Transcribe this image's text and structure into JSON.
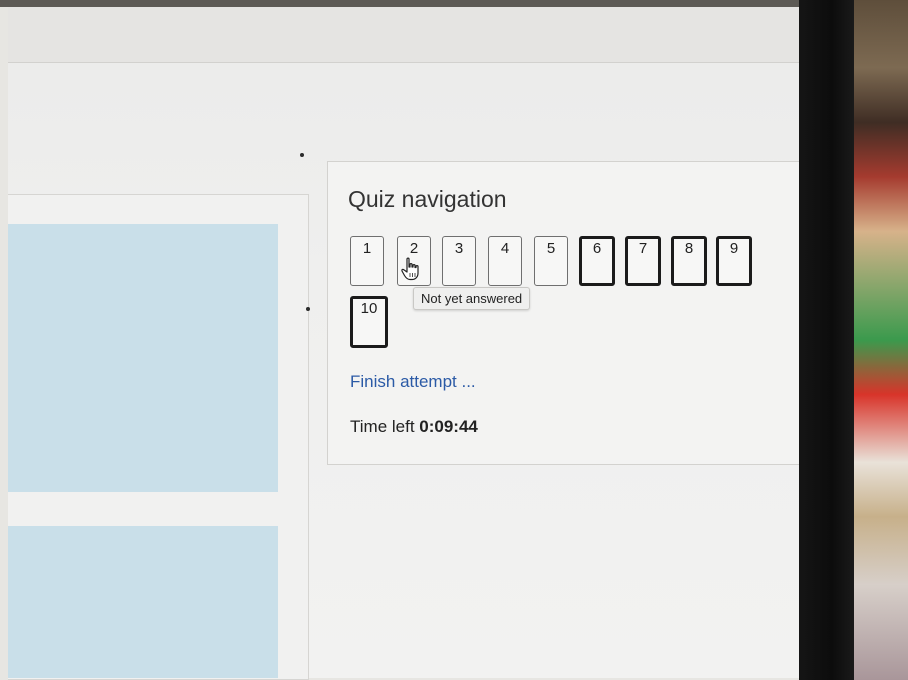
{
  "quiz_navigation": {
    "title": "Quiz navigation",
    "questions": [
      {
        "label": "1",
        "state": "not-answered"
      },
      {
        "label": "2",
        "state": "not-answered"
      },
      {
        "label": "3",
        "state": "not-answered"
      },
      {
        "label": "4",
        "state": "not-answered"
      },
      {
        "label": "5",
        "state": "not-answered"
      },
      {
        "label": "6",
        "state": "answered"
      },
      {
        "label": "7",
        "state": "answered"
      },
      {
        "label": "8",
        "state": "answered"
      },
      {
        "label": "9",
        "state": "answered"
      },
      {
        "label": "10",
        "state": "answered"
      }
    ],
    "tooltip": "Not yet answered",
    "hovered_question": "2",
    "finish_link": "Finish attempt ...",
    "time_left_label": "Time left",
    "time_left_value": "0:09:44"
  },
  "icons": {
    "cursor": "hand-pointer-icon"
  },
  "colors": {
    "link": "#2b5aa6",
    "panel_blue": "#c9dfe9"
  }
}
